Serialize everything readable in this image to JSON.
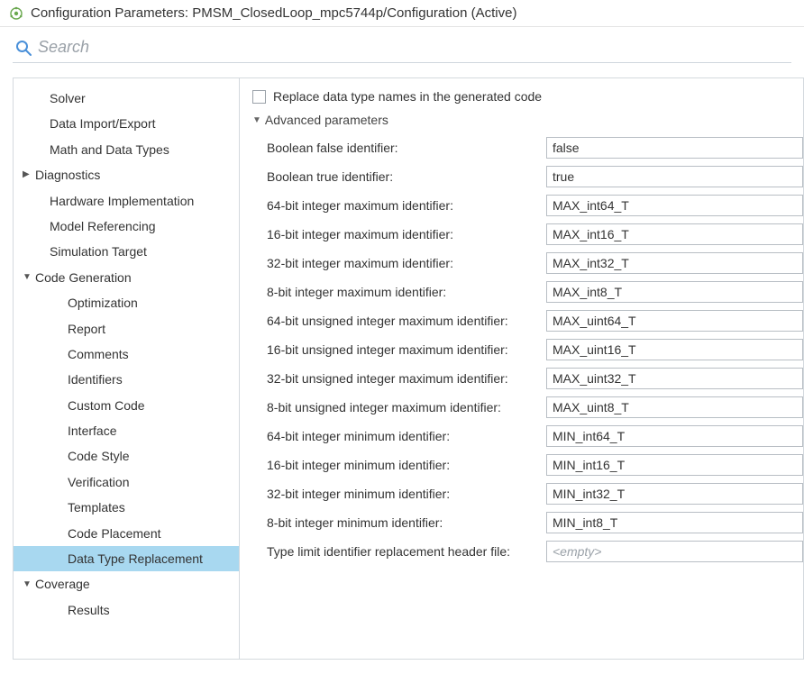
{
  "window": {
    "title": "Configuration Parameters: PMSM_ClosedLoop_mpc5744p/Configuration (Active)"
  },
  "search": {
    "placeholder": "Search"
  },
  "sidebar": {
    "items": [
      {
        "label": "Solver",
        "level": 1,
        "expandable": false
      },
      {
        "label": "Data Import/Export",
        "level": 1,
        "expandable": false
      },
      {
        "label": "Math and Data Types",
        "level": 1,
        "expandable": false
      },
      {
        "label": "Diagnostics",
        "level": 0,
        "expandable": true,
        "expanded": false
      },
      {
        "label": "Hardware Implementation",
        "level": 1,
        "expandable": false
      },
      {
        "label": "Model Referencing",
        "level": 1,
        "expandable": false
      },
      {
        "label": "Simulation Target",
        "level": 1,
        "expandable": false
      },
      {
        "label": "Code Generation",
        "level": 0,
        "expandable": true,
        "expanded": true
      },
      {
        "label": "Optimization",
        "level": 2,
        "expandable": false
      },
      {
        "label": "Report",
        "level": 2,
        "expandable": false
      },
      {
        "label": "Comments",
        "level": 2,
        "expandable": false
      },
      {
        "label": "Identifiers",
        "level": 2,
        "expandable": false
      },
      {
        "label": "Custom Code",
        "level": 2,
        "expandable": false
      },
      {
        "label": "Interface",
        "level": 2,
        "expandable": false
      },
      {
        "label": "Code Style",
        "level": 2,
        "expandable": false
      },
      {
        "label": "Verification",
        "level": 2,
        "expandable": false
      },
      {
        "label": "Templates",
        "level": 2,
        "expandable": false
      },
      {
        "label": "Code Placement",
        "level": 2,
        "expandable": false
      },
      {
        "label": "Data Type Replacement",
        "level": 2,
        "expandable": false,
        "selected": true
      },
      {
        "label": "Coverage",
        "level": 0,
        "expandable": true,
        "expanded": true
      },
      {
        "label": "Results",
        "level": 2,
        "expandable": false
      }
    ]
  },
  "content": {
    "replace_checkbox_label": "Replace data type names in the generated code",
    "advanced_header": "Advanced parameters",
    "params": [
      {
        "label": "Boolean false identifier:",
        "value": "false"
      },
      {
        "label": "Boolean true identifier:",
        "value": "true"
      },
      {
        "label": "64-bit integer maximum identifier:",
        "value": "MAX_int64_T"
      },
      {
        "label": "16-bit integer maximum identifier:",
        "value": "MAX_int16_T"
      },
      {
        "label": "32-bit integer maximum identifier:",
        "value": "MAX_int32_T"
      },
      {
        "label": "8-bit integer maximum identifier:",
        "value": "MAX_int8_T"
      },
      {
        "label": "64-bit unsigned integer maximum identifier:",
        "value": "MAX_uint64_T"
      },
      {
        "label": "16-bit unsigned integer maximum identifier:",
        "value": "MAX_uint16_T"
      },
      {
        "label": "32-bit unsigned integer maximum identifier:",
        "value": "MAX_uint32_T"
      },
      {
        "label": "8-bit unsigned integer maximum identifier:",
        "value": "MAX_uint8_T"
      },
      {
        "label": "64-bit integer minimum identifier:",
        "value": "MIN_int64_T"
      },
      {
        "label": "16-bit integer minimum identifier:",
        "value": "MIN_int16_T"
      },
      {
        "label": "32-bit integer minimum identifier:",
        "value": "MIN_int32_T"
      },
      {
        "label": "8-bit integer minimum identifier:",
        "value": "MIN_int8_T"
      },
      {
        "label": "Type limit identifier replacement header file:",
        "value": "",
        "placeholder": "<empty>"
      }
    ]
  }
}
